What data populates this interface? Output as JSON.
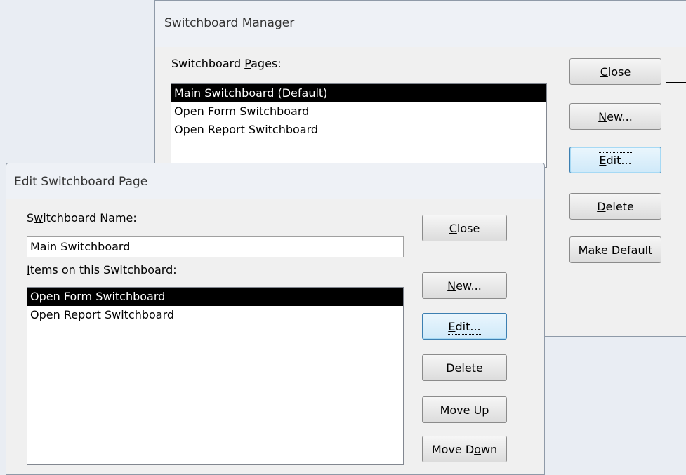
{
  "switchboard_manager": {
    "title": "Switchboard Manager",
    "pages_label": "Switchboard Pages:",
    "pages_label_accel": "P",
    "pages": [
      {
        "label": "Main Switchboard (Default)",
        "selected": true
      },
      {
        "label": "Open Form Switchboard",
        "selected": false
      },
      {
        "label": "Open Report Switchboard",
        "selected": false
      }
    ],
    "buttons": {
      "close": {
        "pre": "",
        "accel": "C",
        "post": "lose"
      },
      "new": {
        "pre": "",
        "accel": "N",
        "post": "ew..."
      },
      "edit": {
        "pre": "",
        "accel": "E",
        "post": "dit..."
      },
      "delete": {
        "pre": "",
        "accel": "D",
        "post": "elete"
      },
      "make_default": {
        "pre": "",
        "accel": "M",
        "post": "ake Default"
      }
    }
  },
  "edit_page": {
    "title": "Edit Switchboard Page",
    "name_label_pre": "S",
    "name_label_accel": "w",
    "name_label_post": "itchboard Name:",
    "name_value": "Main Switchboard",
    "items_label_accel": "I",
    "items_label_post": "tems on this Switchboard:",
    "items": [
      {
        "label": "Open Form Switchboard",
        "selected": true
      },
      {
        "label": "Open Report Switchboard",
        "selected": false
      }
    ],
    "buttons": {
      "close": {
        "pre": "",
        "accel": "C",
        "post": "lose"
      },
      "new": {
        "pre": "",
        "accel": "N",
        "post": "ew..."
      },
      "edit": {
        "pre": "",
        "accel": "E",
        "post": "dit..."
      },
      "delete": {
        "pre": "",
        "accel": "D",
        "post": "elete"
      },
      "move_up": {
        "pre": "Move ",
        "accel": "U",
        "post": "p"
      },
      "move_down": {
        "pre": "Move D",
        "accel": "o",
        "post": "wn"
      }
    }
  }
}
